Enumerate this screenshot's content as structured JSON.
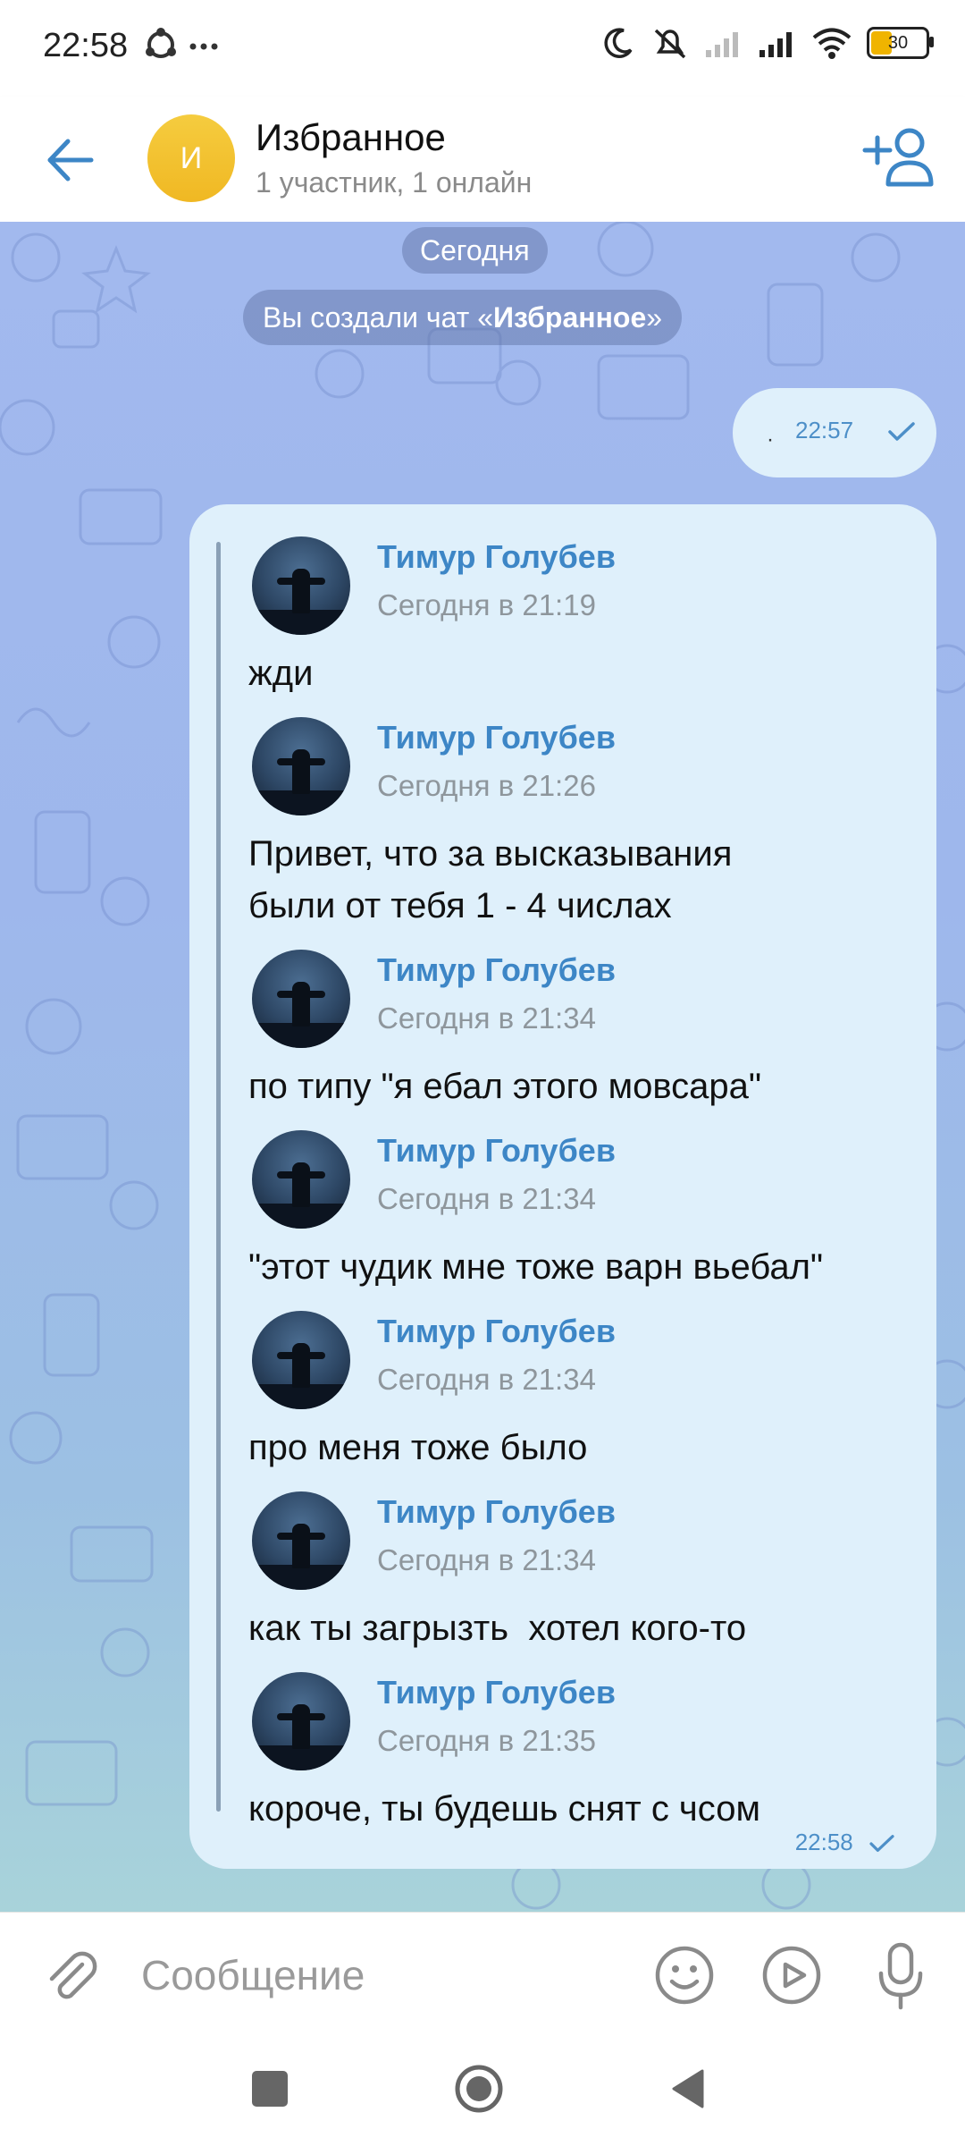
{
  "status_bar": {
    "time": "22:58",
    "battery": "30"
  },
  "header": {
    "avatar_letter": "И",
    "title": "Избранное",
    "subtitle": "1 участник, 1 онлайн"
  },
  "chat": {
    "date_separator": "Сегодня",
    "service_message_prefix": "Вы создали чат «",
    "service_message_name": "Избранное",
    "service_message_suffix": "»",
    "outgoing_small": {
      "text": "·",
      "time": "22:57"
    },
    "forwarded_bubble_time": "22:58",
    "forwarded": [
      {
        "name": "Тимур Голубев",
        "date": "Сегодня в 21:19",
        "text": "жди"
      },
      {
        "name": "Тимур Голубев",
        "date": "Сегодня в 21:26",
        "text": "Привет, что за высказывания были от тебя 1 - 4 числах"
      },
      {
        "name": "Тимур Голубев",
        "date": "Сегодня в 21:34",
        "text": "по типу \"я ебал этого мовсара\""
      },
      {
        "name": "Тимур Голубев",
        "date": "Сегодня в 21:34",
        "text": "\"этот чудик мне тоже варн вьебал\""
      },
      {
        "name": "Тимур Голубев",
        "date": "Сегодня в 21:34",
        "text": "про меня тоже было"
      },
      {
        "name": "Тимур Голубев",
        "date": "Сегодня в 21:34",
        "text": "как ты загрызть  хотел кого-то"
      },
      {
        "name": "Тимур Голубев",
        "date": "Сегодня в 21:35",
        "text": "короче, ты будешь снят с чсом"
      }
    ]
  },
  "composer": {
    "placeholder": "Сообщение"
  },
  "icons": {
    "back": "arrow-left-icon",
    "add_user": "add-user-icon",
    "attach": "paperclip-icon",
    "emoji": "smile-icon",
    "video_message": "play-icon",
    "mic": "microphone-icon"
  },
  "colors": {
    "accent": "#3d86c6",
    "avatar_yellow": "#f0b823",
    "bubble": "#dff0fb"
  }
}
